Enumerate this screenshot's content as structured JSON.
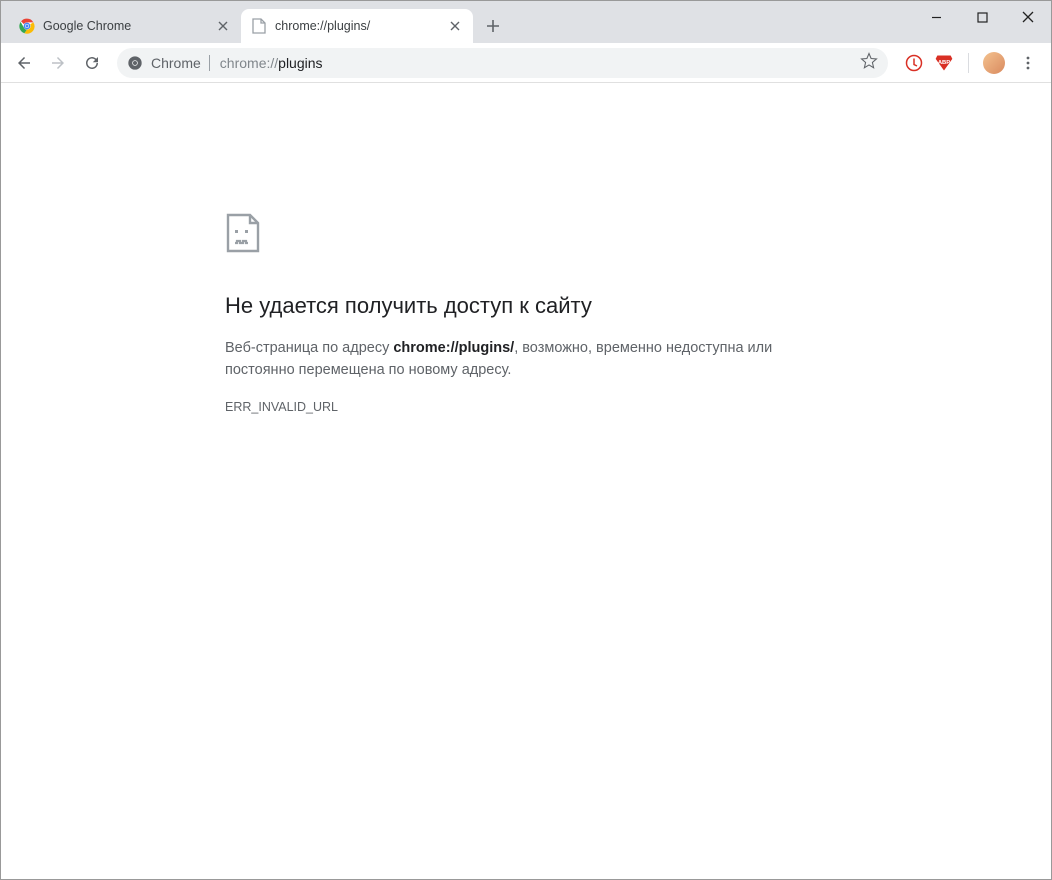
{
  "tabs": [
    {
      "title": "Google Chrome",
      "active": false
    },
    {
      "title": "chrome://plugins/",
      "active": true
    }
  ],
  "omnibox": {
    "scheme_label": "Chrome",
    "url_dim": "chrome://",
    "url_main": "plugins"
  },
  "error_page": {
    "heading": "Не удается получить доступ к сайту",
    "desc_before": "Веб-страница по адресу ",
    "desc_url": "chrome://plugins/",
    "desc_after": ", возможно, временно недоступна или постоянно перемещена по новому адресу.",
    "error_code": "ERR_INVALID_URL"
  }
}
